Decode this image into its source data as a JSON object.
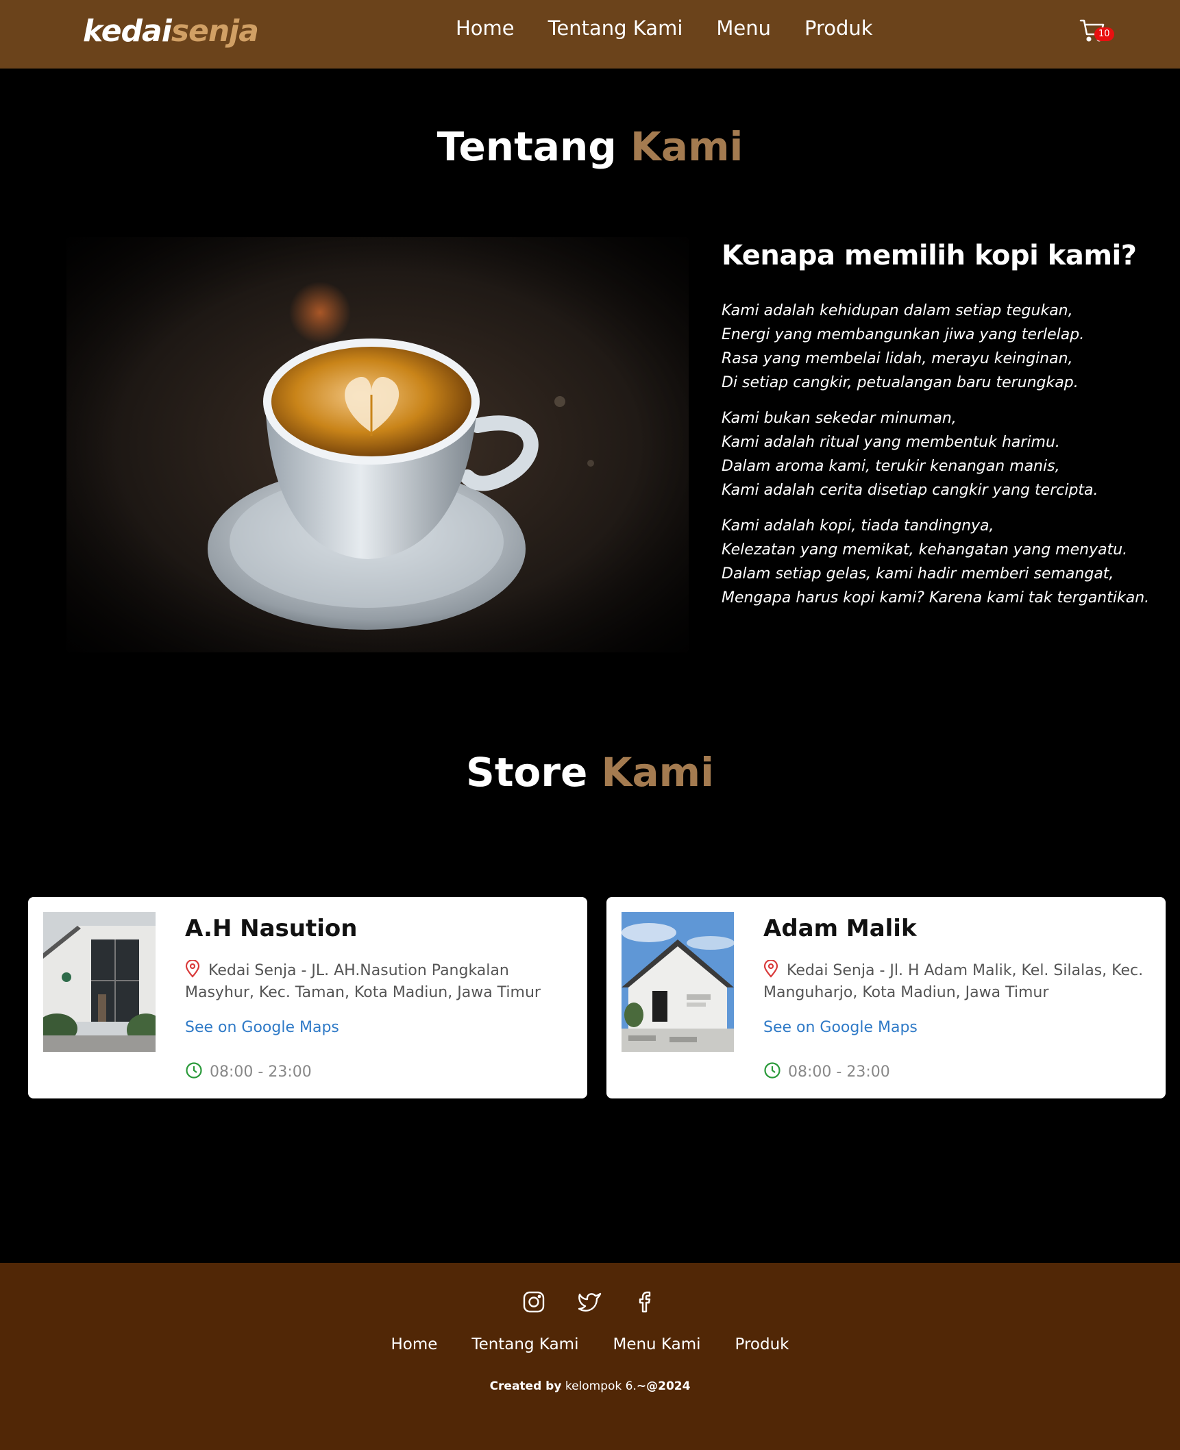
{
  "nav": {
    "logo_part1": "kedai",
    "logo_part2": "senja",
    "links": [
      "Home",
      "Tentang Kami",
      "Menu",
      "Produk"
    ],
    "cart_count": "10"
  },
  "about": {
    "title_part1": "Tentang",
    "title_part2": "Kami",
    "heading": "Kenapa memilih kopi kami?",
    "stanzas": [
      "Kami adalah kehidupan dalam setiap tegukan,\nEnergi yang membangunkan jiwa yang terlelap.\nRasa yang membelai lidah, merayu keinginan,\nDi setiap cangkir, petualangan baru terungkap.",
      "Kami bukan sekedar minuman,\nKami adalah ritual yang membentuk harimu.\nDalam aroma kami, terukir kenangan manis,\nKami adalah cerita disetiap cangkir yang tercipta.",
      "Kami adalah kopi, tiada tandingnya,\nKelezatan yang memikat, kehangatan yang menyatu.\nDalam setiap gelas, kami hadir memberi semangat,\nMengapa harus kopi kami? Karena kami tak tergantikan."
    ]
  },
  "stores": {
    "title_part1": "Store",
    "title_part2": "Kami",
    "items": [
      {
        "name": "A.H Nasution",
        "address": "Kedai Senja - JL. AH.Nasution Pangkalan Masyhur, Kec. Taman, Kota Madiun, Jawa Timur",
        "map_label": "See on Google Maps",
        "hours": "08:00 - 23:00"
      },
      {
        "name": "Adam Malik",
        "address": "Kedai Senja - Jl. H Adam Malik, Kel. Silalas, Kec. Manguharjo, Kota Madiun, Jawa Timur",
        "map_label": "See on Google Maps",
        "hours": "08:00 - 23:00"
      }
    ]
  },
  "footer": {
    "social_icons": [
      "instagram-icon",
      "twitter-icon",
      "facebook-icon"
    ],
    "links": [
      "Home",
      "Tentang Kami",
      "Menu Kami",
      "Produk"
    ],
    "credit_prefix": "Created by",
    "credit_name": "kelompok 6.",
    "credit_suffix": "~@2024"
  },
  "colors": {
    "nav_bg": "#6b431b",
    "footer_bg": "#512706",
    "accent": "#a47b50",
    "logo_accent": "#d1a065"
  }
}
